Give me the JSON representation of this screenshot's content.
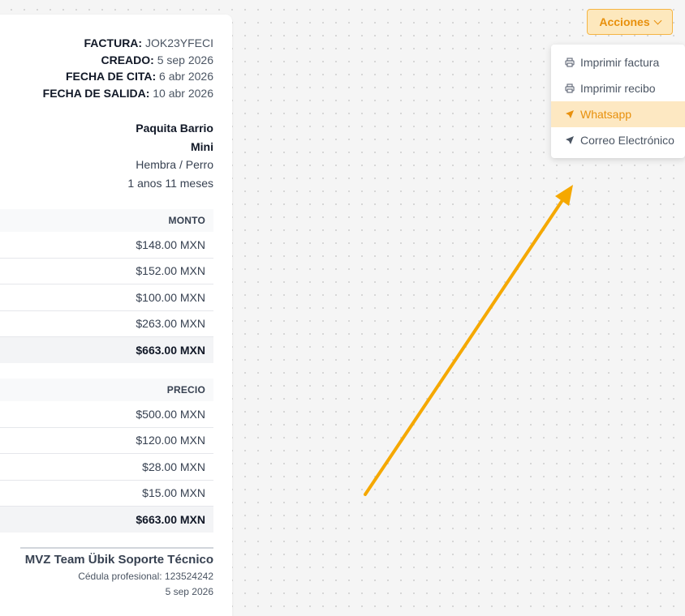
{
  "invoice": {
    "meta": [
      {
        "label": "FACTURA:",
        "value": "JOK23YFECI"
      },
      {
        "label": "CREADO:",
        "value": "5 sep 2026"
      },
      {
        "label": "FECHA DE CITA:",
        "value": "6 abr 2026"
      },
      {
        "label": "FECHA DE SALIDA:",
        "value": "10 abr 2026"
      }
    ],
    "patient": {
      "owner": "Paquita Barrio",
      "pet": "Mini",
      "sex_species": "Hembra / Perro",
      "age": "1 anos 11 meses"
    },
    "montos": {
      "header": "MONTO",
      "rows": [
        "$148.00 MXN",
        "$152.00 MXN",
        "$100.00 MXN",
        "$263.00 MXN"
      ],
      "total": "$663.00 MXN"
    },
    "precios": {
      "header": "PRECIO",
      "rows": [
        "$500.00 MXN",
        "$120.00 MXN",
        "$28.00 MXN",
        "$15.00 MXN"
      ],
      "total": "$663.00 MXN"
    },
    "signature": {
      "name": "MVZ Team Übik Soporte Técnico",
      "license": "Cédula profesional: 123524242",
      "date": "5 sep 2026"
    }
  },
  "actions": {
    "button_label": "Acciones",
    "menu": [
      {
        "label": "Imprimir factura",
        "icon": "printer-icon",
        "active": false
      },
      {
        "label": "Imprimir recibo",
        "icon": "printer-icon",
        "active": false
      },
      {
        "label": "Whatsapp",
        "icon": "send-icon",
        "active": true
      },
      {
        "label": "Correo Electrónico",
        "icon": "send-icon",
        "active": false
      }
    ]
  },
  "colors": {
    "accent": "#e8900c",
    "accent_bg": "#fde8c2",
    "arrow": "#f5a800"
  }
}
